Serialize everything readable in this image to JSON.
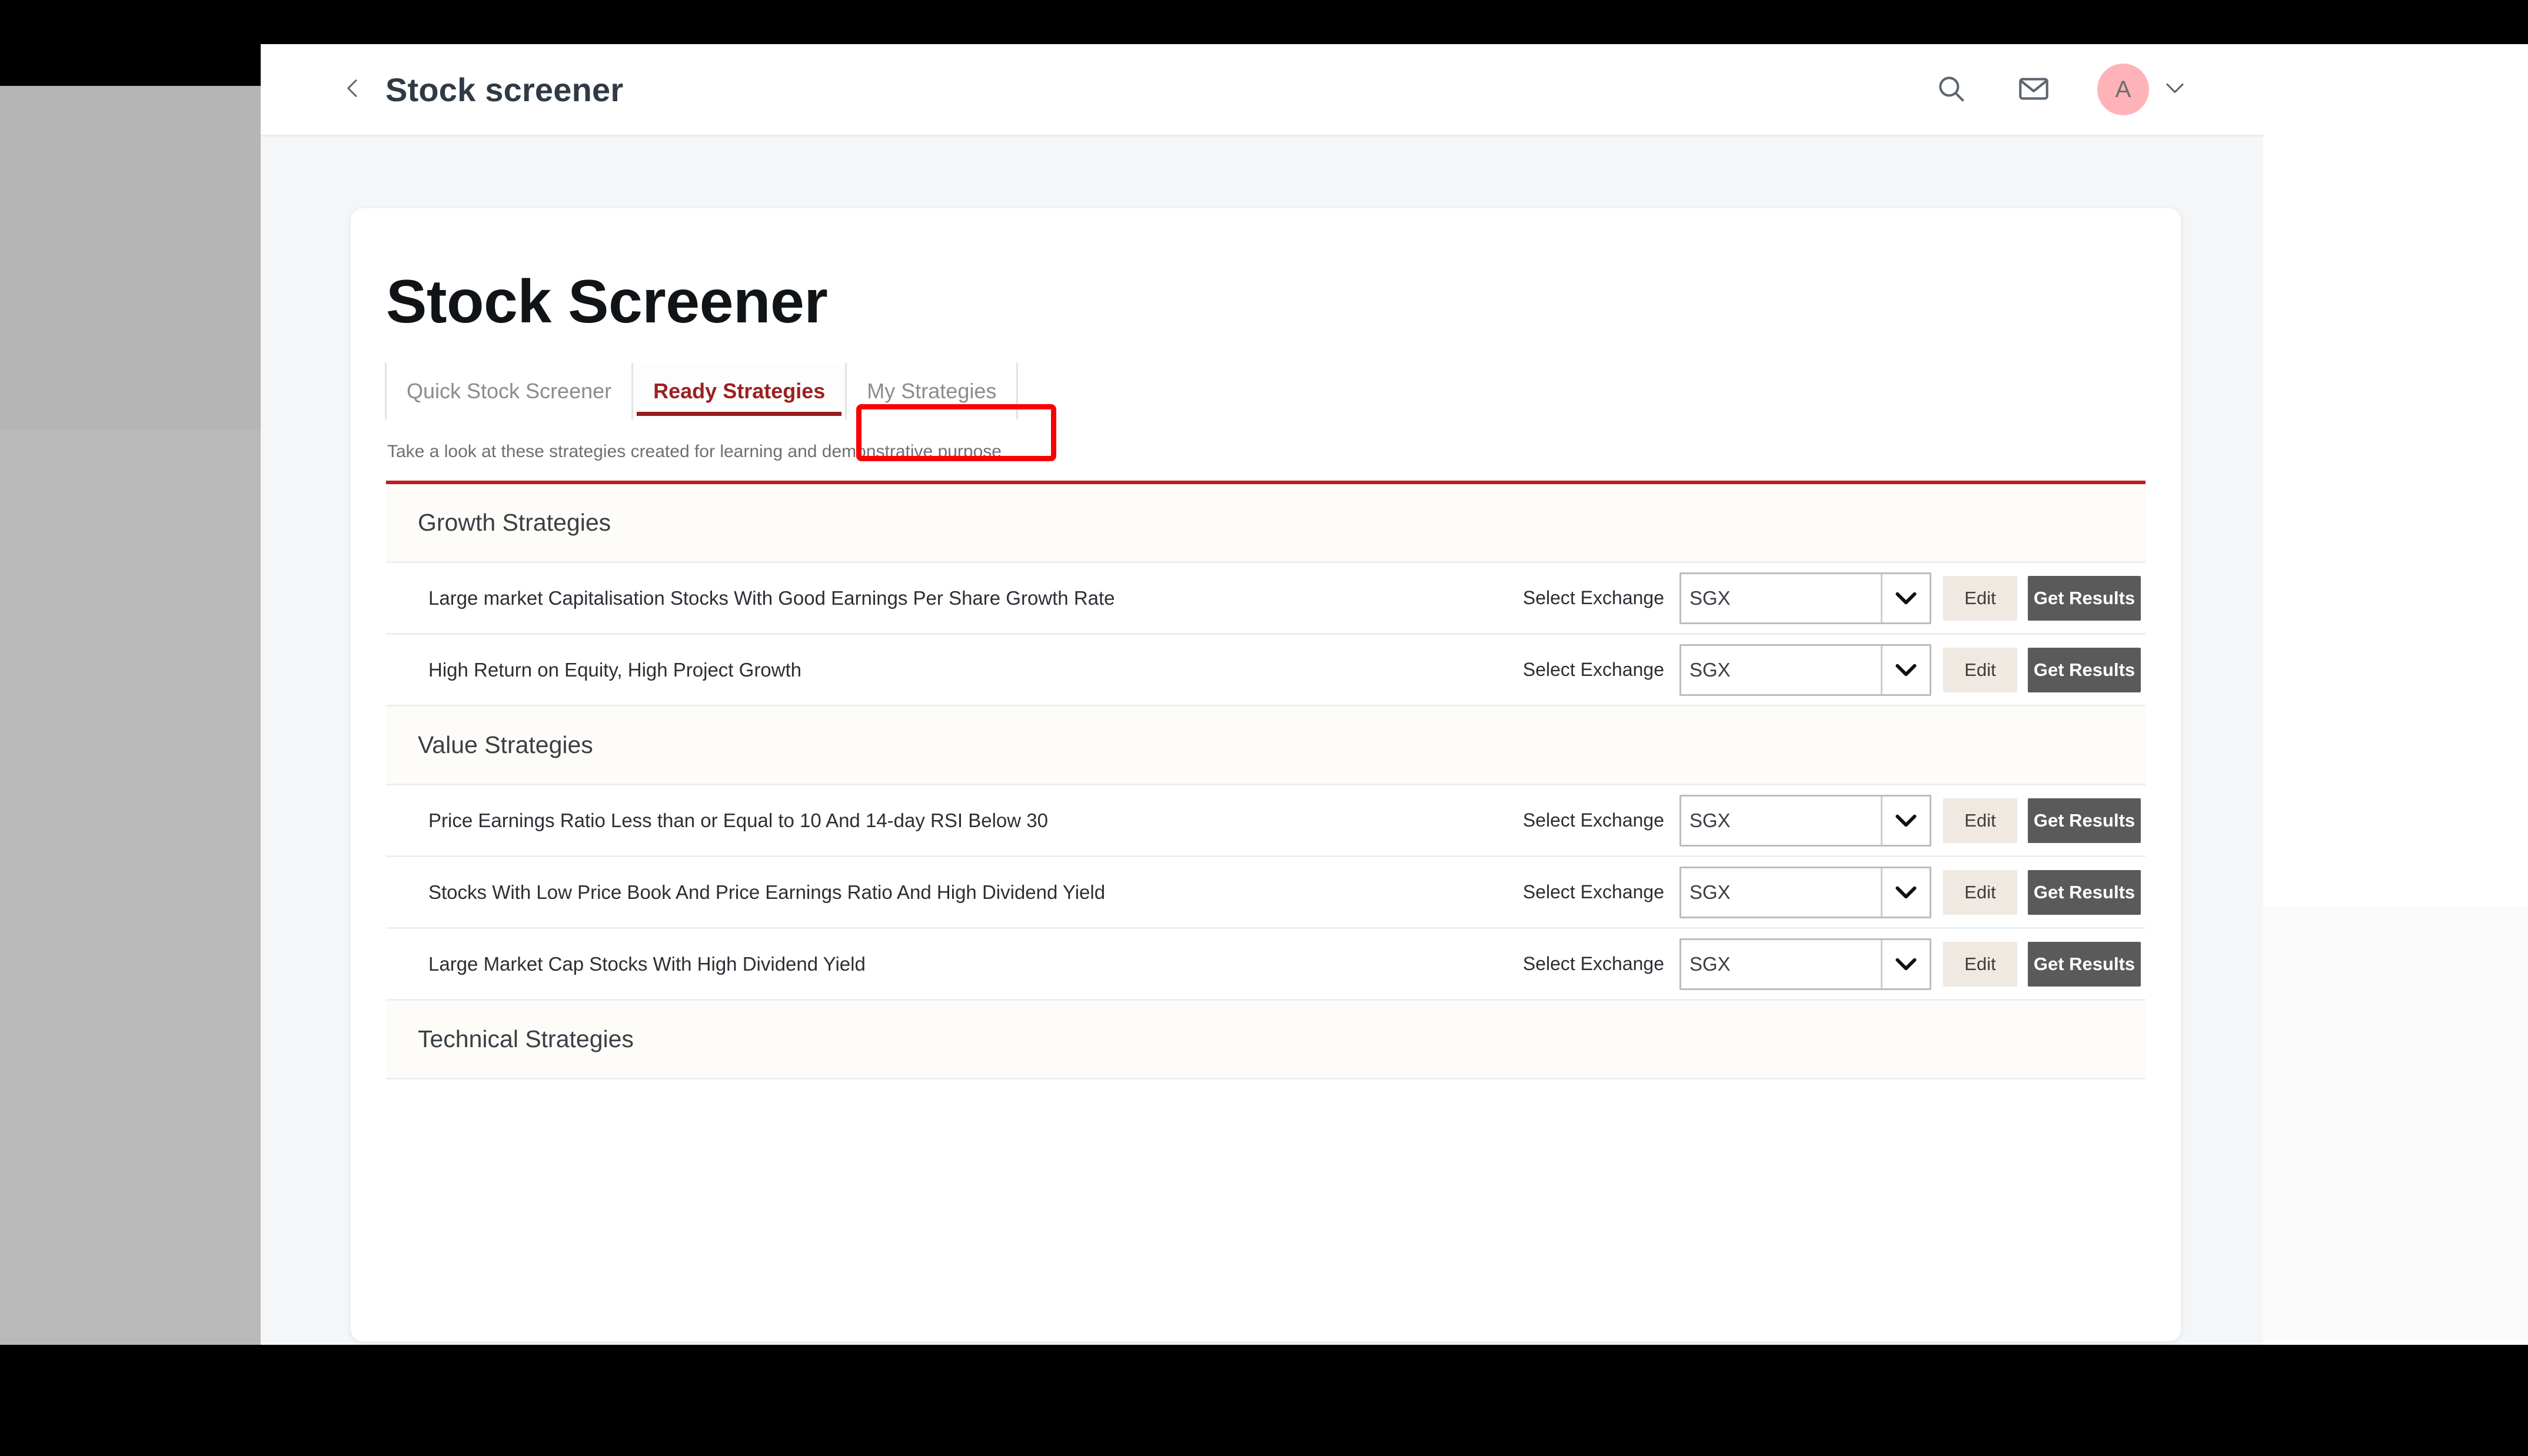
{
  "topbar": {
    "back_icon": "chevron-left-icon",
    "title": "Stock screener",
    "search_icon": "search-icon",
    "mail_icon": "envelope-icon",
    "avatar_initial": "A",
    "avatar_color": "#ffb3b8",
    "avatar_caret_icon": "chevron-down-icon"
  },
  "card": {
    "page_title": "Stock Screener",
    "tabs": [
      {
        "label": "Quick Stock Screener",
        "active": false
      },
      {
        "label": "Ready Strategies",
        "active": true
      },
      {
        "label": "My Strategies",
        "active": false
      }
    ],
    "subtitle": "Take a look at these strategies created for learning and demonstrative purpose",
    "accent_color": "#c41b1b",
    "highlight_color": "#fa0000",
    "controls": {
      "select_label": "Select Exchange",
      "select_value": "SGX",
      "select_caret_icon": "chevron-down-icon",
      "edit_label": "Edit",
      "get_results_label": "Get Results"
    },
    "sections": [
      {
        "title": "Growth Strategies",
        "rows": [
          {
            "name": "Large market Capitalisation Stocks With Good Earnings Per Share Growth Rate"
          },
          {
            "name": "High Return on Equity, High Project Growth"
          }
        ]
      },
      {
        "title": "Value Strategies",
        "rows": [
          {
            "name": "Price Earnings Ratio Less than or Equal to 10 And 14-day RSI Below 30"
          },
          {
            "name": "Stocks With Low Price Book And Price Earnings Ratio And High Dividend Yield"
          },
          {
            "name": "Large Market Cap Stocks With High Dividend Yield"
          }
        ]
      },
      {
        "title": "Technical Strategies",
        "rows": []
      }
    ]
  }
}
